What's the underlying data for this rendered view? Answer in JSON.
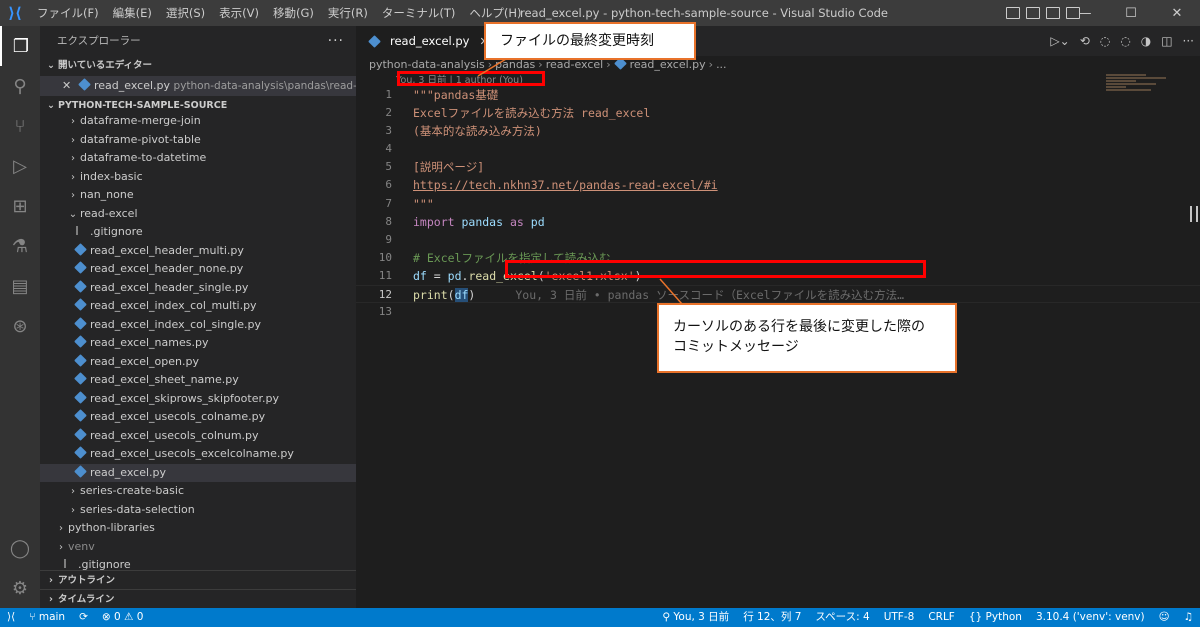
{
  "titlebar": {
    "menus": [
      "ファイル(F)",
      "編集(E)",
      "選択(S)",
      "表示(V)",
      "移動(G)",
      "実行(R)",
      "ターミナル(T)",
      "ヘルプ(H)"
    ],
    "window_title": "read_excel.py - python-tech-sample-source - Visual Studio Code",
    "minimize": "—",
    "maximize": "☐",
    "close": "✕"
  },
  "sidebar": {
    "header": "エクスプローラー",
    "more": "···",
    "open_editors_title": "開いているエディター",
    "open_editor": {
      "name": "read_excel.py",
      "path": "python-data-analysis\\pandas\\read-excel"
    },
    "workspace_title": "PYTHON-TECH-SAMPLE-SOURCE",
    "folders_before": [
      "dataframe-merge-join",
      "dataframe-pivot-table",
      "dataframe-to-datetime",
      "index-basic",
      "nan_none"
    ],
    "open_folder": "read-excel",
    "gitignore_child": ".gitignore",
    "files": [
      "read_excel_header_multi.py",
      "read_excel_header_none.py",
      "read_excel_header_single.py",
      "read_excel_index_col_multi.py",
      "read_excel_index_col_single.py",
      "read_excel_names.py",
      "read_excel_open.py",
      "read_excel_sheet_name.py",
      "read_excel_skiprows_skipfooter.py",
      "read_excel_usecols_colname.py",
      "read_excel_usecols_colnum.py",
      "read_excel_usecols_excelcolname.py",
      "read_excel.py"
    ],
    "folders_after": [
      "series-create-basic",
      "series-data-selection"
    ],
    "root_folders": [
      "python-libraries",
      "venv"
    ],
    "root_gitignore": ".gitignore",
    "outline": "アウトライン",
    "timeline": "タイムライン"
  },
  "editor": {
    "tab_label": "read_excel.py",
    "breadcrumb": [
      "python-data-analysis",
      "pandas",
      "read-excel",
      "read_excel.py",
      "..."
    ],
    "codelens": "You, 3 日前 | 1 author (You)",
    "line_numbers": [
      "1",
      "2",
      "3",
      "4",
      "5",
      "6",
      "7",
      "8",
      "9",
      "10",
      "11",
      "12",
      "13"
    ],
    "lines": {
      "l1": "\"\"\"pandas基礎",
      "l2": "Excelファイルを読み込む方法 read_excel",
      "l3": "(基本的な読み込み方法)",
      "l5": "[説明ページ]",
      "l6": "https://tech.nkhn37.net/pandas-read-excel/#i",
      "l7": "\"\"\"",
      "l8_import": "import",
      "l8_mod": "pandas",
      "l8_as": "as",
      "l8_alias": "pd",
      "l10": "# Excelファイルを指定して読み込む",
      "l11_var": "df",
      "l11_eq": " = ",
      "l11_pd": "pd",
      "l11_dot": ".",
      "l11_fn": "read_excel",
      "l11_open": "(",
      "l11_str": "'excel1.xlsx'",
      "l11_close": ")",
      "l12_fn": "print",
      "l12_open": "(",
      "l12_arg": "df",
      "l12_close": ")",
      "l12_blame": "You, 3 日前 • pandas ソースコード（Excelファイルを読み込む方法…"
    }
  },
  "annotations": {
    "top": "ファイルの最終変更時刻",
    "bottom_line1": "カーソルのある行を最後に変更した際の",
    "bottom_line2": "コミットメッセージ"
  },
  "statusbar": {
    "branch": "main",
    "sync": "⟳",
    "problems": "⊗ 0 ⚠ 0",
    "blame": "You, 3 日前",
    "position": "行 12、列 7",
    "spaces": "スペース: 4",
    "encoding": "UTF-8",
    "eol": "CRLF",
    "language": "Python",
    "interpreter": "3.10.4 ('venv': venv)"
  },
  "colors": {
    "accent": "#007acc",
    "callout_border": "#e8722a",
    "highlight_box": "#ff0000"
  }
}
